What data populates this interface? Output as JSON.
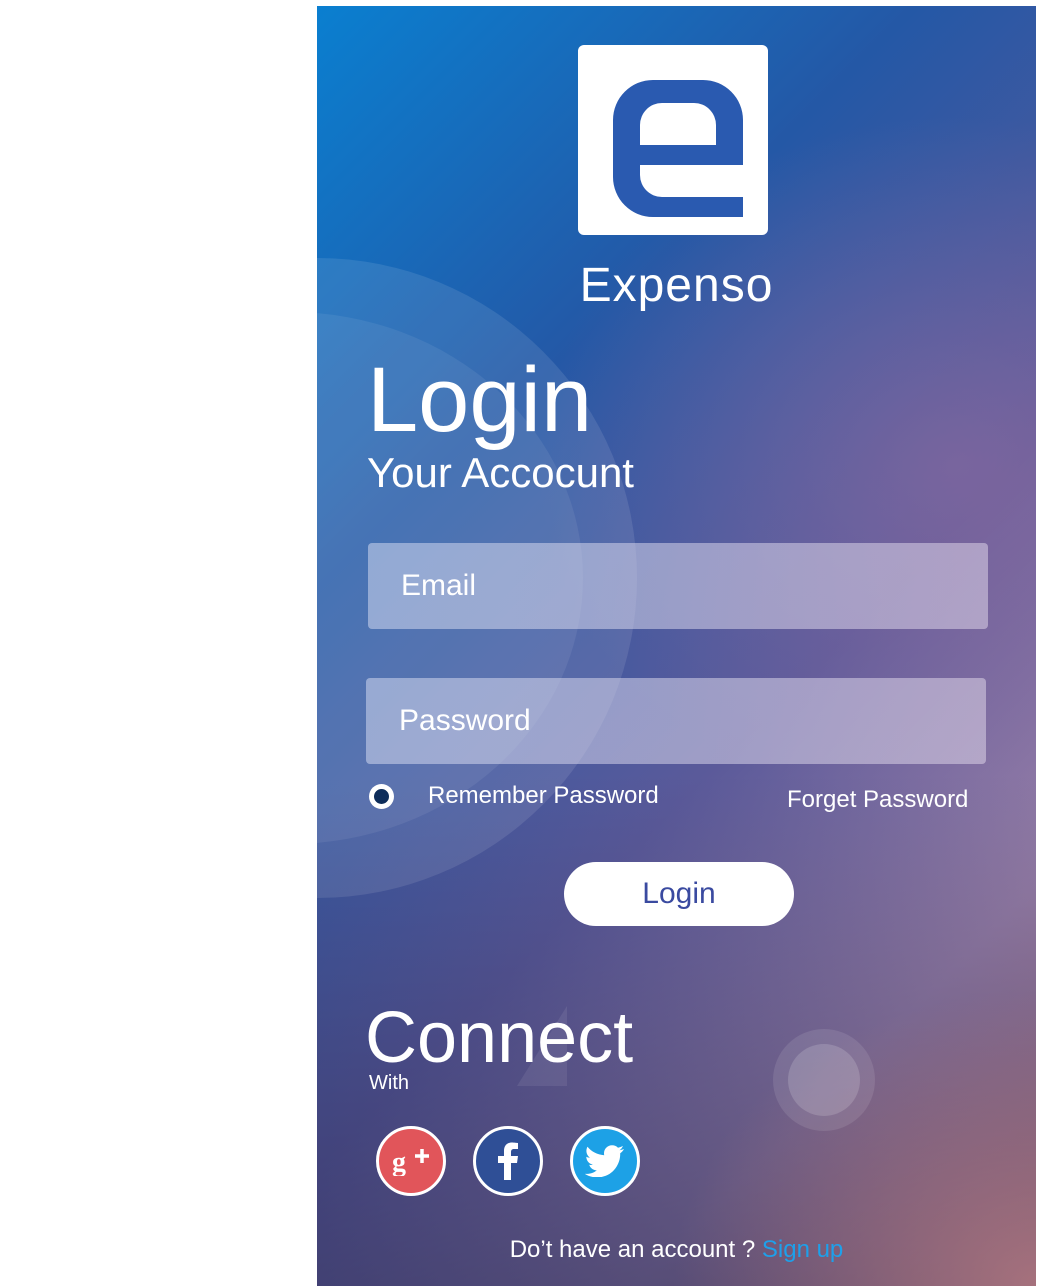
{
  "app": {
    "name": "Expenso"
  },
  "heading": {
    "title": "Login",
    "subtitle": "Your Accocunt"
  },
  "form": {
    "email_placeholder": "Email",
    "password_placeholder": "Password",
    "remember_label": "Remember Password",
    "forget_label": "Forget Password",
    "login_button": "Login"
  },
  "connect": {
    "title": "Connect",
    "subtitle": "With",
    "providers": [
      {
        "name": "google-plus",
        "icon": "google-plus-icon",
        "color": "#e1555a"
      },
      {
        "name": "facebook",
        "icon": "facebook-icon",
        "color": "#2f4f96"
      },
      {
        "name": "twitter",
        "icon": "twitter-icon",
        "color": "#1da1e6"
      }
    ]
  },
  "footer": {
    "prompt": "Do’t have an account ? ",
    "signup_link": "Sign up"
  },
  "colors": {
    "accent": "#1ea0ea",
    "button_text": "#3a4aa0",
    "logo_blue": "#2a5ab0"
  }
}
